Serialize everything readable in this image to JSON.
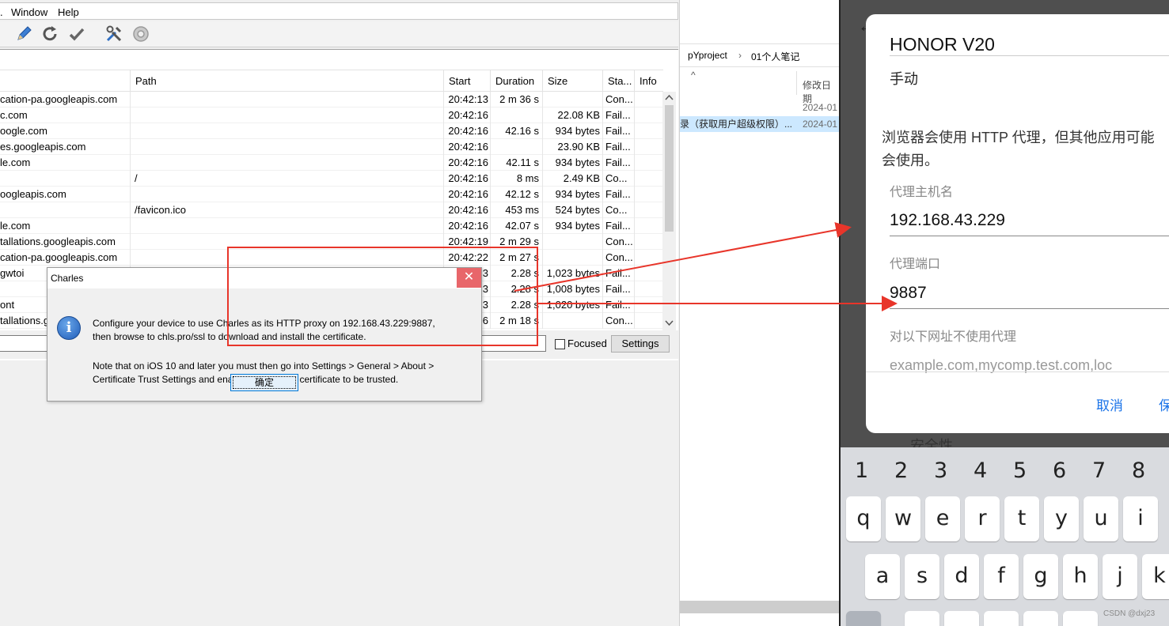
{
  "charles": {
    "menu": [
      "Window",
      "Help"
    ],
    "icons": [
      "pen-icon",
      "refresh-icon",
      "check-icon",
      "tools-icon",
      "gear-icon"
    ],
    "columns": [
      "Path",
      "Start",
      "Duration",
      "Size",
      "Sta...",
      "Info"
    ],
    "rows": [
      {
        "host": "cation-pa.googleapis.com",
        "path": "",
        "start": "20:42:13",
        "duration": "2 m 36 s",
        "size": "",
        "status": "Con..."
      },
      {
        "host": "c.com",
        "path": "",
        "start": "20:42:16",
        "duration": "",
        "size": "22.08 KB",
        "status": "Fail..."
      },
      {
        "host": "oogle.com",
        "path": "",
        "start": "20:42:16",
        "duration": "42.16 s",
        "size": "934 bytes",
        "status": "Fail..."
      },
      {
        "host": "es.googleapis.com",
        "path": "",
        "start": "20:42:16",
        "duration": "",
        "size": "23.90 KB",
        "status": "Fail..."
      },
      {
        "host": "le.com",
        "path": "",
        "start": "20:42:16",
        "duration": "42.11 s",
        "size": "934 bytes",
        "status": "Fail..."
      },
      {
        "host": "",
        "path": "/",
        "start": "20:42:16",
        "duration": "8 ms",
        "size": "2.49 KB",
        "status": "Co..."
      },
      {
        "host": "oogleapis.com",
        "path": "",
        "start": "20:42:16",
        "duration": "42.12 s",
        "size": "934 bytes",
        "status": "Fail..."
      },
      {
        "host": "",
        "path": "/favicon.ico",
        "start": "20:42:16",
        "duration": "453 ms",
        "size": "524 bytes",
        "status": "Co..."
      },
      {
        "host": "le.com",
        "path": "",
        "start": "20:42:16",
        "duration": "42.07 s",
        "size": "934 bytes",
        "status": "Fail..."
      },
      {
        "host": "tallations.googleapis.com",
        "path": "",
        "start": "20:42:19",
        "duration": "2 m 29 s",
        "size": "",
        "status": "Con..."
      },
      {
        "host": "cation-pa.googleapis.com",
        "path": "",
        "start": "20:42:22",
        "duration": "2 m 27 s",
        "size": "",
        "status": "Con..."
      },
      {
        "host": "gwtoi",
        "path": "",
        "start": "3",
        "duration": "2.28 s",
        "size": "1,023 bytes",
        "status": "Fail..."
      },
      {
        "host": "",
        "path": "",
        "start": "3",
        "duration": "2.28 s",
        "size": "1,008 bytes",
        "status": "Fail..."
      },
      {
        "host": "ont",
        "path": "",
        "start": "3",
        "duration": "2.28 s",
        "size": "1,020 bytes",
        "status": "Fail..."
      },
      {
        "host": "tallations.g",
        "path": "",
        "start": "6",
        "duration": "2 m 18 s",
        "size": "",
        "status": "Con..."
      }
    ],
    "focused_label": "Focused",
    "settings_label": "Settings"
  },
  "dialog": {
    "title": "Charles",
    "close": "✕",
    "info_glyph": "i",
    "line1": "Configure your device to use Charles as its HTTP proxy on 192.168.43.229:9887,",
    "line2": "then browse to chls.pro/ssl to download and install the certificate.",
    "line3": "Note that on iOS 10 and later you must then go into Settings > General > About >",
    "line4": "Certificate Trust Settings and enable the Charles certificate to be trusted.",
    "ok": "确定"
  },
  "explorer": {
    "crumb1": "pYproject",
    "crumb_sep": "›",
    "crumb2": "01个人笔记",
    "sort_glyph": "^",
    "col_date": "修改日期",
    "rows": [
      {
        "name": "",
        "date": "2024-01"
      },
      {
        "name": "录（获取用户超级权限）...",
        "date": "2024-01"
      }
    ]
  },
  "phone": {
    "back_glyph": "←",
    "title": "HONOR V20",
    "mode": "手动",
    "warning_l1": "浏览器会使用 HTTP 代理，但其他应用可能",
    "warning_l2": "会使用。",
    "host_label": "代理主机名",
    "host_value": "192.168.43.229",
    "port_label": "代理端口",
    "port_value": "9887",
    "bypass_label": "对以下网址不使用代理",
    "bypass_placeholder": "example.com,mycomp.test.com,loc",
    "cancel": "取消",
    "save": "保",
    "behind_text": "安全性",
    "numbers": [
      "1",
      "2",
      "3",
      "4",
      "5",
      "6",
      "7",
      "8"
    ],
    "row1": [
      "q",
      "w",
      "e",
      "r",
      "t",
      "y",
      "u",
      "i"
    ],
    "row2": [
      "a",
      "s",
      "d",
      "f",
      "g",
      "h",
      "j",
      "k"
    ]
  },
  "watermark": "CSDN @dxj23",
  "colors": {
    "annotation_red": "#e8352a",
    "phone_accent": "#1a73e8",
    "close_red": "#e8666a"
  }
}
